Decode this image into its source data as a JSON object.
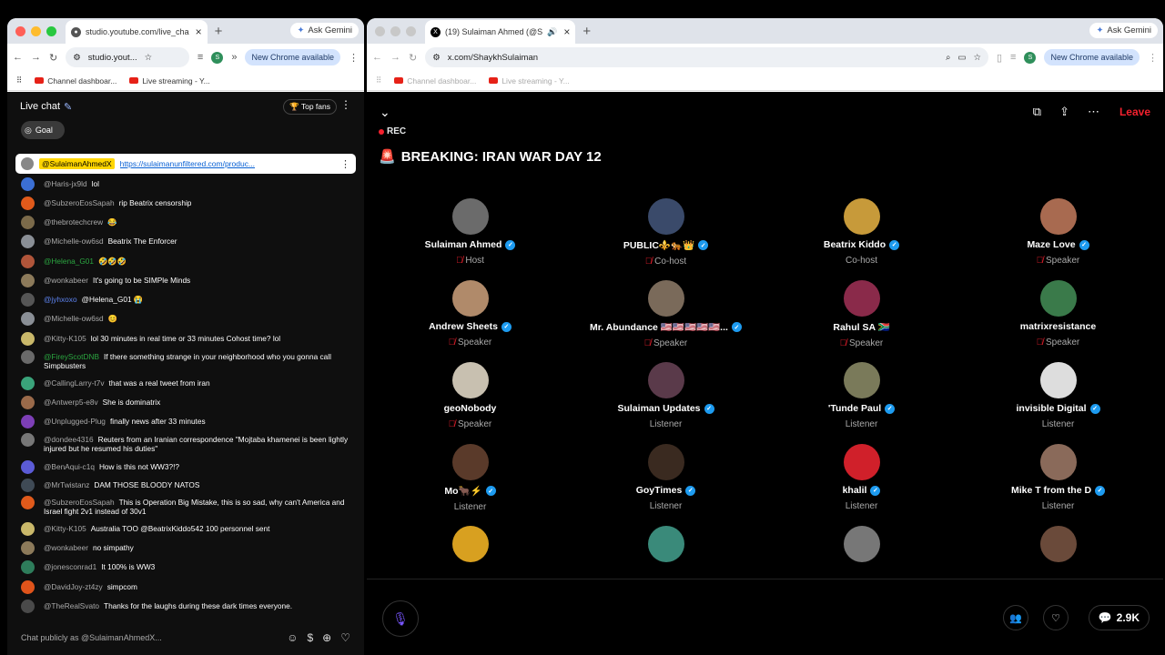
{
  "left_window": {
    "tab_title": "studio.youtube.com/live_cha",
    "address": "studio.yout...",
    "new_chrome": "New Chrome available",
    "gemini": "Ask Gemini",
    "bookmarks": [
      "Channel dashboar...",
      "Live streaming - Y..."
    ],
    "chat": {
      "title": "Live chat",
      "top_fans": "Top fans",
      "goal": "Goal",
      "pinned": {
        "author": "@SulaimanAhmedX",
        "link": "https://sulaimanunfiltered.com/produc..."
      },
      "messages": [
        {
          "author": "@Haris-jx9ld",
          "text": "lol",
          "color": "#3b6fd4",
          "author_color": "#aaa"
        },
        {
          "author": "@SubzeroEosSapah",
          "text": "rip Beatrix censorship",
          "color": "#e05a1b",
          "author_color": "#aaa"
        },
        {
          "author": "@thebrotechcrew",
          "text": "😂",
          "color": "#7b6a4a",
          "author_color": "#aaa"
        },
        {
          "author": "@Michelle-ow6sd",
          "text": "Beatrix The Enforcer",
          "color": "#8a8f96",
          "author_color": "#aaa"
        },
        {
          "author": "@Helena_G01",
          "text": "🤣🤣🤣",
          "color": "#b0553a",
          "author_color": "#2ba640"
        },
        {
          "author": "@wonkabeer",
          "text": "It's going to be SIMPle Minds",
          "color": "#8c7a5a",
          "author_color": "#aaa"
        },
        {
          "author": "@jyhxoxo",
          "text": "@Helena_G01 😭",
          "color": "#555",
          "author_color": "#5e84f1"
        },
        {
          "author": "@Michelle-ow6sd",
          "text": "😊",
          "color": "#8a8f96",
          "author_color": "#aaa"
        },
        {
          "author": "@Kitty-K105",
          "text": "lol 30 minutes in real time or 33 minutes Cohost time? lol",
          "color": "#c9b86a",
          "author_color": "#aaa"
        },
        {
          "author": "@FireyScotDNB",
          "text": "If there something strange in your neighborhood who you gonna call Simpbusters",
          "color": "#6a6a6a",
          "author_color": "#2ba640"
        },
        {
          "author": "@CallingLarry-t7v",
          "text": "that was a real tweet from iran",
          "color": "#3aa37a",
          "author_color": "#aaa"
        },
        {
          "author": "@Antwerp5-e8v",
          "text": "She is dominatrix",
          "color": "#9a6a4a",
          "author_color": "#aaa"
        },
        {
          "author": "@Unplugged-Plug",
          "text": "finally news after 33 minutes",
          "color": "#7d3fb6",
          "author_color": "#aaa"
        },
        {
          "author": "@dondee4316",
          "text": "Reuters from an Iranian correspondence \"Mojtaba khamenei is been lightly injured but he resumed his duties\"",
          "color": "#777",
          "author_color": "#aaa"
        },
        {
          "author": "@BenAqui-c1q",
          "text": "How is this not WW3?!?",
          "color": "#5b5bd6",
          "author_color": "#aaa"
        },
        {
          "author": "@MrTwistanz",
          "text": "DAM THOSE BLOODY NATOS",
          "color": "#3f4a55",
          "author_color": "#aaa"
        },
        {
          "author": "@SubzeroEosSapah",
          "text": "This is Operation Big Mistake, this is so sad, why can't America and Israel fight 2v1 instead of 30v1",
          "color": "#e05a1b",
          "author_color": "#aaa"
        },
        {
          "author": "@Kitty-K105",
          "text": "Australia TOO @BeatrixKiddo542 100 personnel sent",
          "color": "#c9b86a",
          "author_color": "#aaa"
        },
        {
          "author": "@wonkabeer",
          "text": "no simpathy",
          "color": "#8c7a5a",
          "author_color": "#aaa"
        },
        {
          "author": "@jonesconrad1",
          "text": "It 100% is WW3",
          "color": "#2e7d5b",
          "author_color": "#aaa"
        },
        {
          "author": "@DavidJoy-zt4zy",
          "text": "simpcom",
          "color": "#e0541b",
          "author_color": "#aaa"
        },
        {
          "author": "@TheRealSvato",
          "text": "Thanks for the laughs during these dark times everyone.",
          "color": "#4a4a4a",
          "author_color": "#aaa"
        }
      ],
      "input_placeholder": "Chat publicly as @SulaimanAhmedX..."
    }
  },
  "right_window": {
    "tab_title": "(19) Sulaiman Ahmed (@S",
    "address": "x.com/ShaykhSulaiman",
    "new_chrome": "New Chrome available",
    "gemini": "Ask Gemini",
    "bookmarks": [
      "Channel dashboar...",
      "Live streaming - Y..."
    ],
    "space": {
      "rec": "REC",
      "title": "BREAKING: IRAN WAR DAY 12",
      "leave": "Leave",
      "participants": [
        {
          "name": "Sulaiman Ahmed",
          "role": "Host",
          "verified": true,
          "mic": true,
          "color": "#6b6b6b"
        },
        {
          "name": "PUBLIC⚜️🐅👑",
          "role": "Co-host",
          "verified": true,
          "mic": true,
          "color": "#3a4a6a"
        },
        {
          "name": "Beatrix Kiddo",
          "role": "Co-host",
          "verified": true,
          "mic": false,
          "color": "#c79a3a"
        },
        {
          "name": "Maze Love",
          "role": "Speaker",
          "verified": true,
          "mic": true,
          "color": "#a86a50"
        },
        {
          "name": "Andrew Sheets",
          "role": "Speaker",
          "verified": true,
          "mic": true,
          "color": "#b08a6a"
        },
        {
          "name": "Mr. Abundance 🇺🇸🇺🇸🇺🇸🇺🇸🇺🇸...",
          "role": "Speaker",
          "verified": true,
          "mic": true,
          "color": "#7a6a5a"
        },
        {
          "name": "Rahul SA 🇿🇦",
          "role": "Speaker",
          "verified": false,
          "mic": true,
          "color": "#8a2a4a"
        },
        {
          "name": "matrixresistance",
          "role": "Speaker",
          "verified": false,
          "mic": true,
          "color": "#3a7a4a"
        },
        {
          "name": "geoNobody",
          "role": "Speaker",
          "verified": false,
          "mic": true,
          "color": "#c8c0b0"
        },
        {
          "name": "Sulaiman Updates",
          "role": "Listener",
          "verified": true,
          "mic": false,
          "color": "#5a3a4a"
        },
        {
          "name": "'Tunde Paul",
          "role": "Listener",
          "verified": true,
          "mic": false,
          "color": "#7a7a5a"
        },
        {
          "name": "invisible Digital",
          "role": "Listener",
          "verified": true,
          "mic": false,
          "color": "#dddddd"
        },
        {
          "name": "Mo🐂⚡",
          "role": "Listener",
          "verified": true,
          "mic": false,
          "color": "#5a3a2a"
        },
        {
          "name": "GoyTimes",
          "role": "Listener",
          "verified": true,
          "mic": false,
          "color": "#3a2a20"
        },
        {
          "name": "khalil",
          "role": "Listener",
          "verified": true,
          "mic": false,
          "color": "#d0202a"
        },
        {
          "name": "Mike T from the D",
          "role": "Listener",
          "verified": true,
          "mic": false,
          "color": "#8a6a5a"
        },
        {
          "name": "",
          "role": "",
          "verified": false,
          "mic": false,
          "color": "#d8a020"
        },
        {
          "name": "",
          "role": "",
          "verified": false,
          "mic": false,
          "color": "#3a8a7a"
        },
        {
          "name": "",
          "role": "",
          "verified": false,
          "mic": false,
          "color": "#777777"
        },
        {
          "name": "",
          "role": "",
          "verified": false,
          "mic": false,
          "color": "#6a4a3a"
        }
      ],
      "reply_count": "2.9K"
    }
  }
}
